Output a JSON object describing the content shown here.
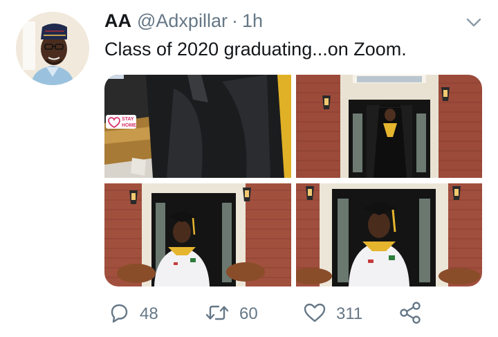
{
  "tweet": {
    "display_name": "AA",
    "handle": "@Adxpillar",
    "separator": "·",
    "time": "1h",
    "text": "Class of 2020 graduating...on Zoom."
  },
  "media": {
    "tiles": [
      {
        "subject": "gown-closeup-photo",
        "sticker_line1": "STAY",
        "sticker_line2": "HOME"
      },
      {
        "subject": "graduate-at-door-wide-photo"
      },
      {
        "subject": "graduate-at-door-medium-photo"
      },
      {
        "subject": "graduate-at-door-closeup-photo"
      }
    ]
  },
  "actions": {
    "reply_count": "48",
    "retweet_count": "60",
    "like_count": "311"
  },
  "icons": {
    "reply": "reply-icon",
    "retweet": "retweet-icon",
    "like": "heart-icon",
    "share": "share-icon",
    "more": "chevron-down-icon"
  },
  "colors": {
    "text": "#14171a",
    "secondary": "#657786",
    "sticker": "#d6336c"
  }
}
